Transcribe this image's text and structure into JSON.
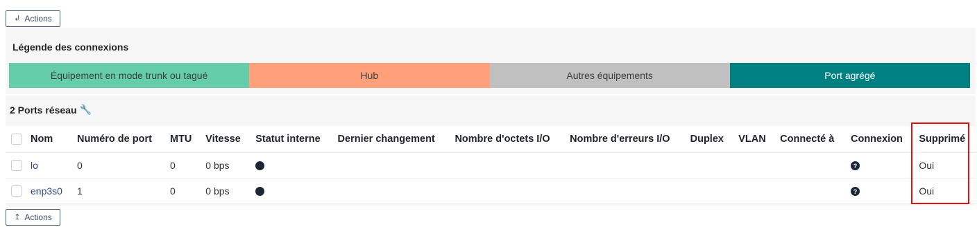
{
  "actions_top": {
    "label": "Actions",
    "icon": "arrow-return-left-icon"
  },
  "actions_bottom": {
    "label": "Actions",
    "icon": "arrow-return-up-icon"
  },
  "legend": {
    "title": "Légende des connexions",
    "items": [
      {
        "label": "Équipement en mode trunk ou tagué",
        "color": "#66cdaa"
      },
      {
        "label": "Hub",
        "color": "#ffa07a"
      },
      {
        "label": "Autres équipements",
        "color": "#c0c0c0"
      },
      {
        "label": "Port agrégé",
        "color": "#008080"
      }
    ]
  },
  "ports": {
    "title": "2 Ports réseau",
    "title_icon": "wrench-icon",
    "columns": [
      "Nom",
      "Numéro de port",
      "MTU",
      "Vitesse",
      "Statut interne",
      "Dernier changement",
      "Nombre d'octets I/O",
      "Nombre d'erreurs I/O",
      "Duplex",
      "VLAN",
      "Connecté à",
      "Connexion",
      "Supprimé"
    ],
    "rows": [
      {
        "name": "lo",
        "port_number": "0",
        "mtu": "0",
        "speed": "0 bps",
        "internal_status": "status-dot",
        "last_change": "",
        "octets": "",
        "errors": "",
        "duplex": "",
        "vlan": "",
        "connected_to": "",
        "connection": "help-icon",
        "deleted": "Oui"
      },
      {
        "name": "enp3s0",
        "port_number": "1",
        "mtu": "0",
        "speed": "0 bps",
        "internal_status": "status-dot",
        "last_change": "",
        "octets": "",
        "errors": "",
        "duplex": "",
        "vlan": "",
        "connected_to": "",
        "connection": "help-icon",
        "deleted": "Oui"
      }
    ]
  },
  "highlight_color": "#e01010"
}
